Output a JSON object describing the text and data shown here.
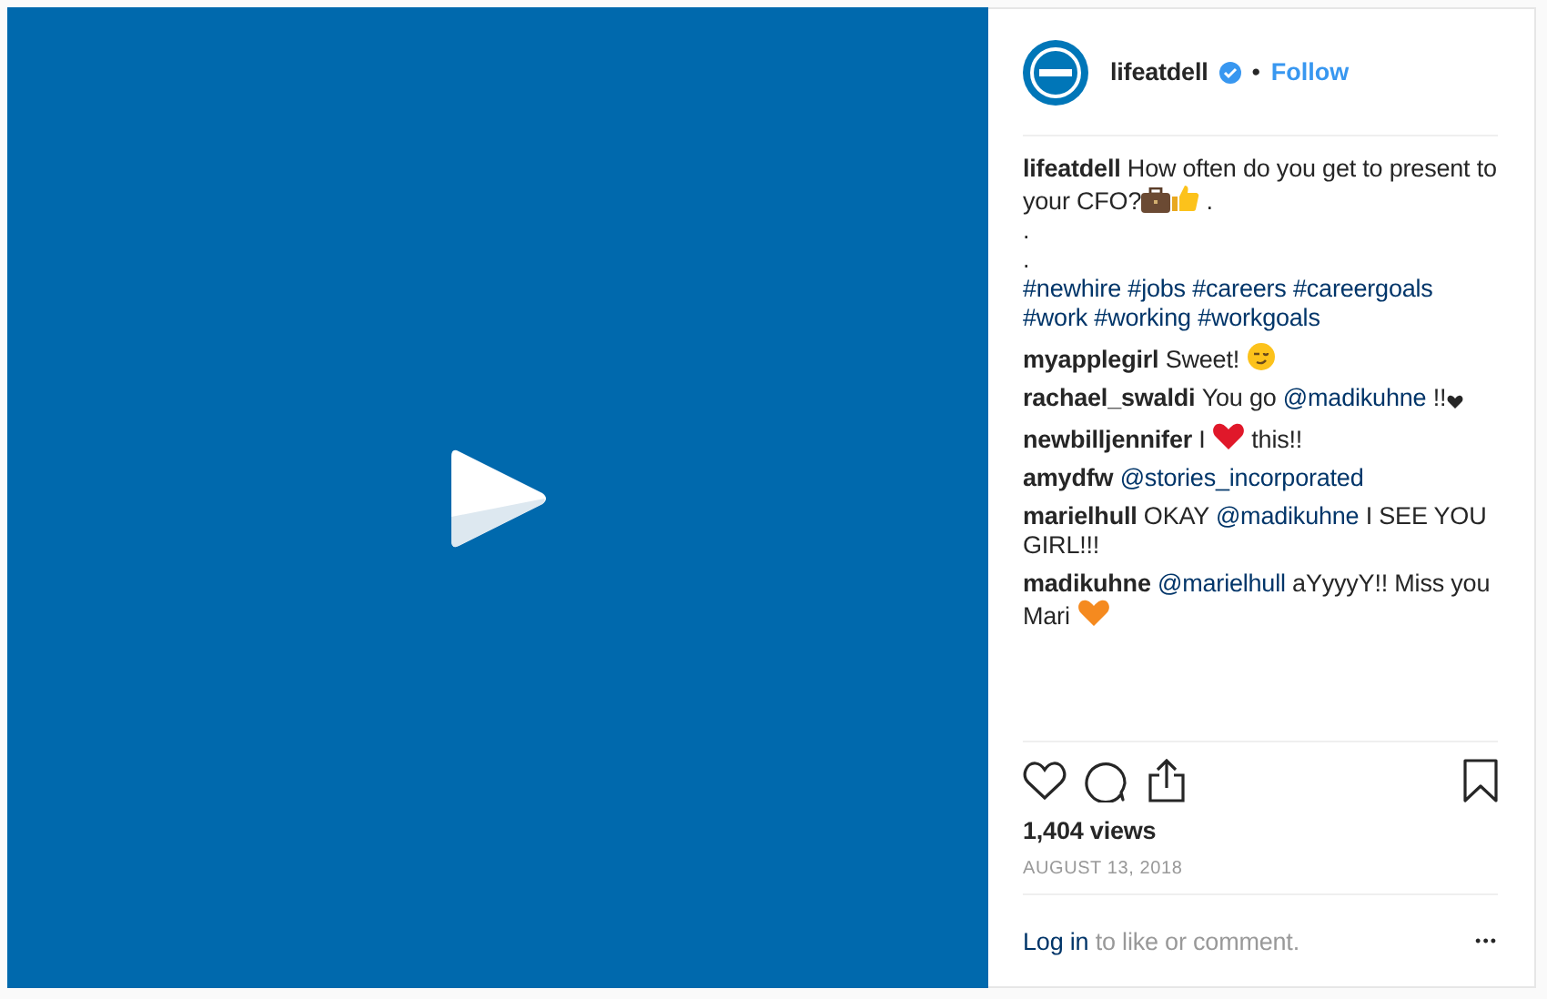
{
  "account": {
    "username": "lifeatdell",
    "verified": true,
    "follow": "Follow",
    "separator": "•"
  },
  "caption": {
    "user": "lifeatdell",
    "parts": [
      {
        "kind": "text",
        "text": "How often do you get to present to your CFO?"
      },
      {
        "kind": "briefcase"
      },
      {
        "kind": "thumbs"
      },
      {
        "kind": "text",
        "text": " ."
      }
    ],
    "dots": [
      ".",
      "."
    ],
    "hashtags": [
      "#newhire",
      "#jobs",
      "#careers",
      "#careergoals",
      "#work",
      "#working",
      "#workgoals"
    ]
  },
  "comments": [
    {
      "user": "myapplegirl",
      "parts": [
        {
          "kind": "text",
          "text": "Sweet! "
        },
        {
          "kind": "wink"
        }
      ]
    },
    {
      "user": "rachael_swaldi",
      "parts": [
        {
          "kind": "text",
          "text": "You go "
        },
        {
          "kind": "mention",
          "text": "@madikuhne"
        },
        {
          "kind": "text",
          "text": " !!"
        },
        {
          "kind": "small-heart"
        }
      ]
    },
    {
      "user": "newbilljennifer",
      "parts": [
        {
          "kind": "text",
          "text": "I "
        },
        {
          "kind": "heart"
        },
        {
          "kind": "text",
          "text": " this!!"
        }
      ]
    },
    {
      "user": "amydfw",
      "parts": [
        {
          "kind": "mention",
          "text": "@stories_incorporated"
        }
      ]
    },
    {
      "user": "marielhull",
      "parts": [
        {
          "kind": "text",
          "text": "OKAY "
        },
        {
          "kind": "mention",
          "text": "@madikuhne"
        },
        {
          "kind": "text",
          "text": " I SEE YOU GIRL!!!"
        }
      ]
    },
    {
      "user": "madikuhne",
      "parts": [
        {
          "kind": "mention",
          "text": "@marielhull"
        },
        {
          "kind": "text",
          "text": " aYyyyY!! Miss you Mari "
        },
        {
          "kind": "orange-heart"
        }
      ]
    }
  ],
  "views": "1,404 views",
  "date": "AUGUST 13, 2018",
  "login": {
    "link": "Log in",
    "text": "to like or comment."
  },
  "more": "•••"
}
